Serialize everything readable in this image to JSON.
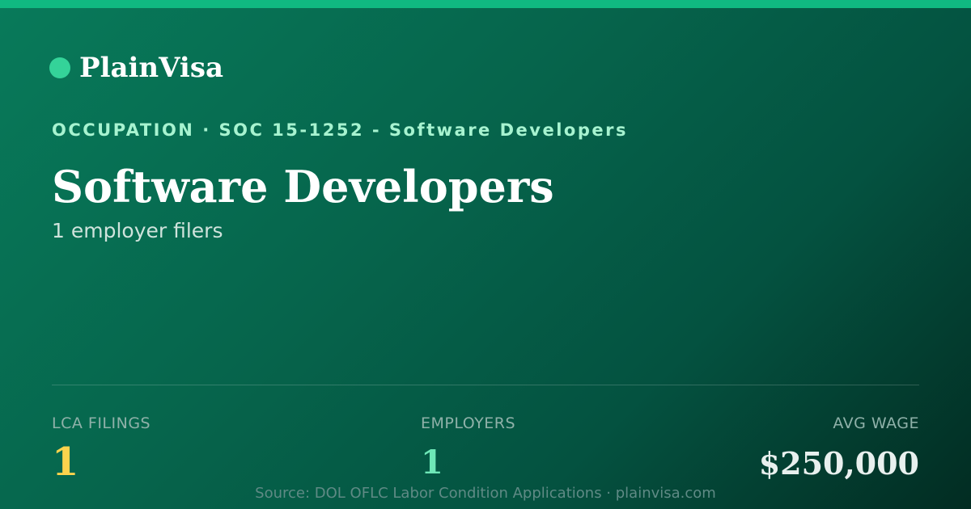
{
  "brand": {
    "name": "PlainVisa",
    "dot_icon": "brand-dot-icon"
  },
  "header": {
    "eyebrow": "OCCUPATION · SOC 15-1252 - Software Developers",
    "title": "Software Developers",
    "subtitle": "1 employer filers"
  },
  "stats": [
    {
      "label": "LCA FILINGS",
      "value": "1"
    },
    {
      "label": "EMPLOYERS",
      "value": "1"
    },
    {
      "label": "AVG WAGE",
      "value": "$250,000"
    }
  ],
  "footer": {
    "source": "Source: DOL OFLC Labor Condition Applications · plainvisa.com"
  },
  "colors": {
    "accent": "#10b981",
    "brand_dot": "#34d399",
    "eyebrow": "#a7f3d0",
    "lca_value": "#fcd34d",
    "employers_value": "#6ee7b7",
    "wage_value": "#e8f0ee"
  }
}
